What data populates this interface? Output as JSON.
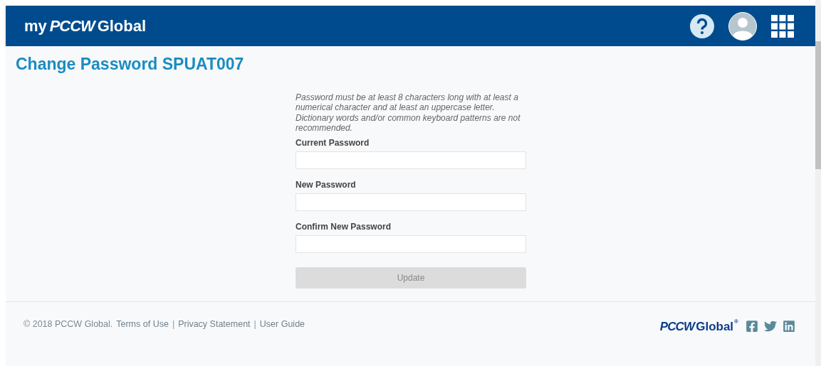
{
  "header": {
    "logo": [
      "my",
      "PCCW",
      "Global"
    ]
  },
  "page": {
    "title": "Change Password SPUAT007"
  },
  "form": {
    "hint": "Password must be at least 8 characters long with at least a numerical character and at least an uppercase letter. Dictionary words and/or common keyboard patterns are not recommended.",
    "fields": [
      {
        "label": "Current Password"
      },
      {
        "label": "New Password"
      },
      {
        "label": "Confirm New Password"
      }
    ],
    "submit": {
      "label": "Update",
      "disabled": true
    }
  },
  "footer": {
    "items": [
      {
        "kind": "text",
        "text": "© 2018 PCCW Global."
      },
      {
        "kind": "link",
        "text": "Terms of Use"
      },
      {
        "kind": "separator",
        "text": "|"
      },
      {
        "kind": "link",
        "text": "Privacy Statement"
      },
      {
        "kind": "separator",
        "text": "|"
      },
      {
        "kind": "link",
        "text": "User Guide"
      }
    ],
    "logo": [
      "PCCW",
      "Global",
      "®"
    ]
  }
}
